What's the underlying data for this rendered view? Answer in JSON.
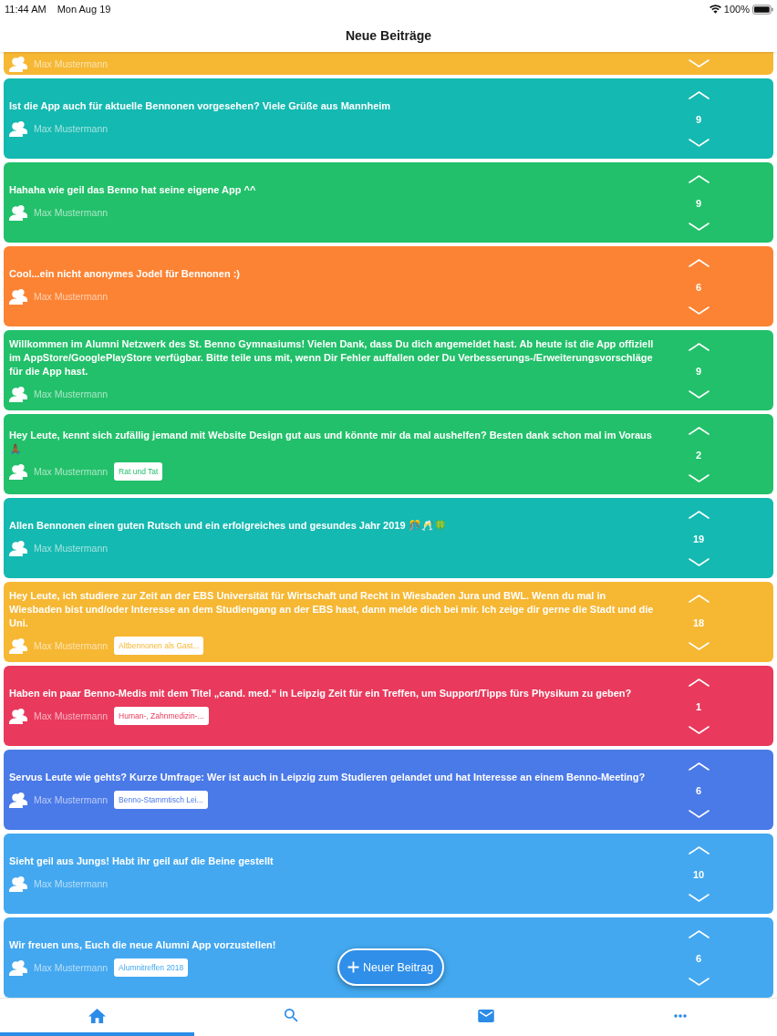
{
  "status_bar": {
    "time": "11:44 AM",
    "date": "Mon Aug 19",
    "battery": "100%"
  },
  "header": {
    "title": "Neue Beiträge"
  },
  "posts": [
    {
      "cut_off": true,
      "color": "#f6b733",
      "author": "Max Mustermann"
    },
    {
      "cut_off": false,
      "color": "#14b9b1",
      "text": "Ist die App auch für aktuelle Bennonen vorgesehen? Viele Grüße aus Mannheim",
      "author": "Max Mustermann",
      "votes": "9"
    },
    {
      "cut_off": false,
      "color": "#22c06a",
      "text": "Hahaha wie geil das Benno hat seine eigene App ^^",
      "author": "Max Mustermann",
      "votes": "9"
    },
    {
      "cut_off": false,
      "color": "#fc8333",
      "text": "Cool...ein nicht anonymes Jodel für Bennonen :)",
      "author": "Max Mustermann",
      "votes": "6"
    },
    {
      "cut_off": false,
      "color": "#22c06a",
      "text": "Willkommen im Alumni Netzwerk des St. Benno Gymnasiums! Vielen Dank, dass Du dich angemeldet hast. Ab heute ist die App offiziell im AppStore/GooglePlayStore verfügbar. Bitte teile uns mit, wenn Dir Fehler auffallen oder Du Verbesserungs-/Erweiterungsvorschläge für die App hast.",
      "author": "Max Mustermann",
      "votes": "9"
    },
    {
      "cut_off": false,
      "color": "#22c06a",
      "text": "Hey Leute, kennt sich zufällig jemand mit Website Design gut aus und könnte mir da mal aushelfen? Besten dank schon mal im Voraus 🙏🏾",
      "author": "Max Mustermann",
      "tag": "Rat und Tat",
      "votes": "2"
    },
    {
      "cut_off": false,
      "color": "#14b9b1",
      "text": "Allen Bennonen einen guten Rutsch und ein erfolgreiches und gesundes Jahr 2019 🎊🥂🍀",
      "author": "Max Mustermann",
      "votes": "19"
    },
    {
      "cut_off": false,
      "color": "#f6b733",
      "text": "Hey Leute, ich studiere zur Zeit an der EBS Universität für Wirtschaft und Recht in Wiesbaden Jura und BWL. Wenn du mal in Wiesbaden bist und/oder Interesse an dem Studiengang an der EBS hast, dann melde dich bei mir. Ich zeige dir gerne die Stadt und die Uni.",
      "author": "Max Mustermann",
      "tag": "Altbennonen als Gast...",
      "votes": "18"
    },
    {
      "cut_off": false,
      "color": "#e9395c",
      "text": "Haben ein paar Benno-Medis mit dem Titel „cand. med.“ in Leipzig Zeit für ein Treffen, um Support/Tipps fürs Physikum zu geben?",
      "author": "Max Mustermann",
      "tag": "Human-, Zahnmedizin-...",
      "votes": "1"
    },
    {
      "cut_off": false,
      "color": "#4a79e8",
      "text": "Servus Leute wie gehts? Kurze Umfrage: Wer ist auch in Leipzig zum Studieren gelandet und hat Interesse an einem Benno-Meeting?",
      "author": "Max Mustermann",
      "tag": "Benno-Stammtisch Lei...",
      "votes": "6"
    },
    {
      "cut_off": false,
      "color": "#43a8f0",
      "text": "Sieht geil aus Jungs! Habt ihr geil auf die Beine gestellt",
      "author": "Max Mustermann",
      "votes": "10"
    },
    {
      "cut_off": false,
      "color": "#43a8f0",
      "text": "Wir freuen uns, Euch die neue Alumni App vorzustellen!",
      "author": "Max Mustermann",
      "tag": "Alumnitreffen 2018",
      "votes": "6"
    }
  ],
  "new_post_button": {
    "label": "Neuer Beitrag"
  },
  "tab_bar": {
    "tabs": [
      {
        "kind": "home",
        "selected": true
      },
      {
        "kind": "search",
        "selected": false
      },
      {
        "kind": "mail",
        "selected": false
      },
      {
        "kind": "more",
        "selected": false
      }
    ]
  }
}
